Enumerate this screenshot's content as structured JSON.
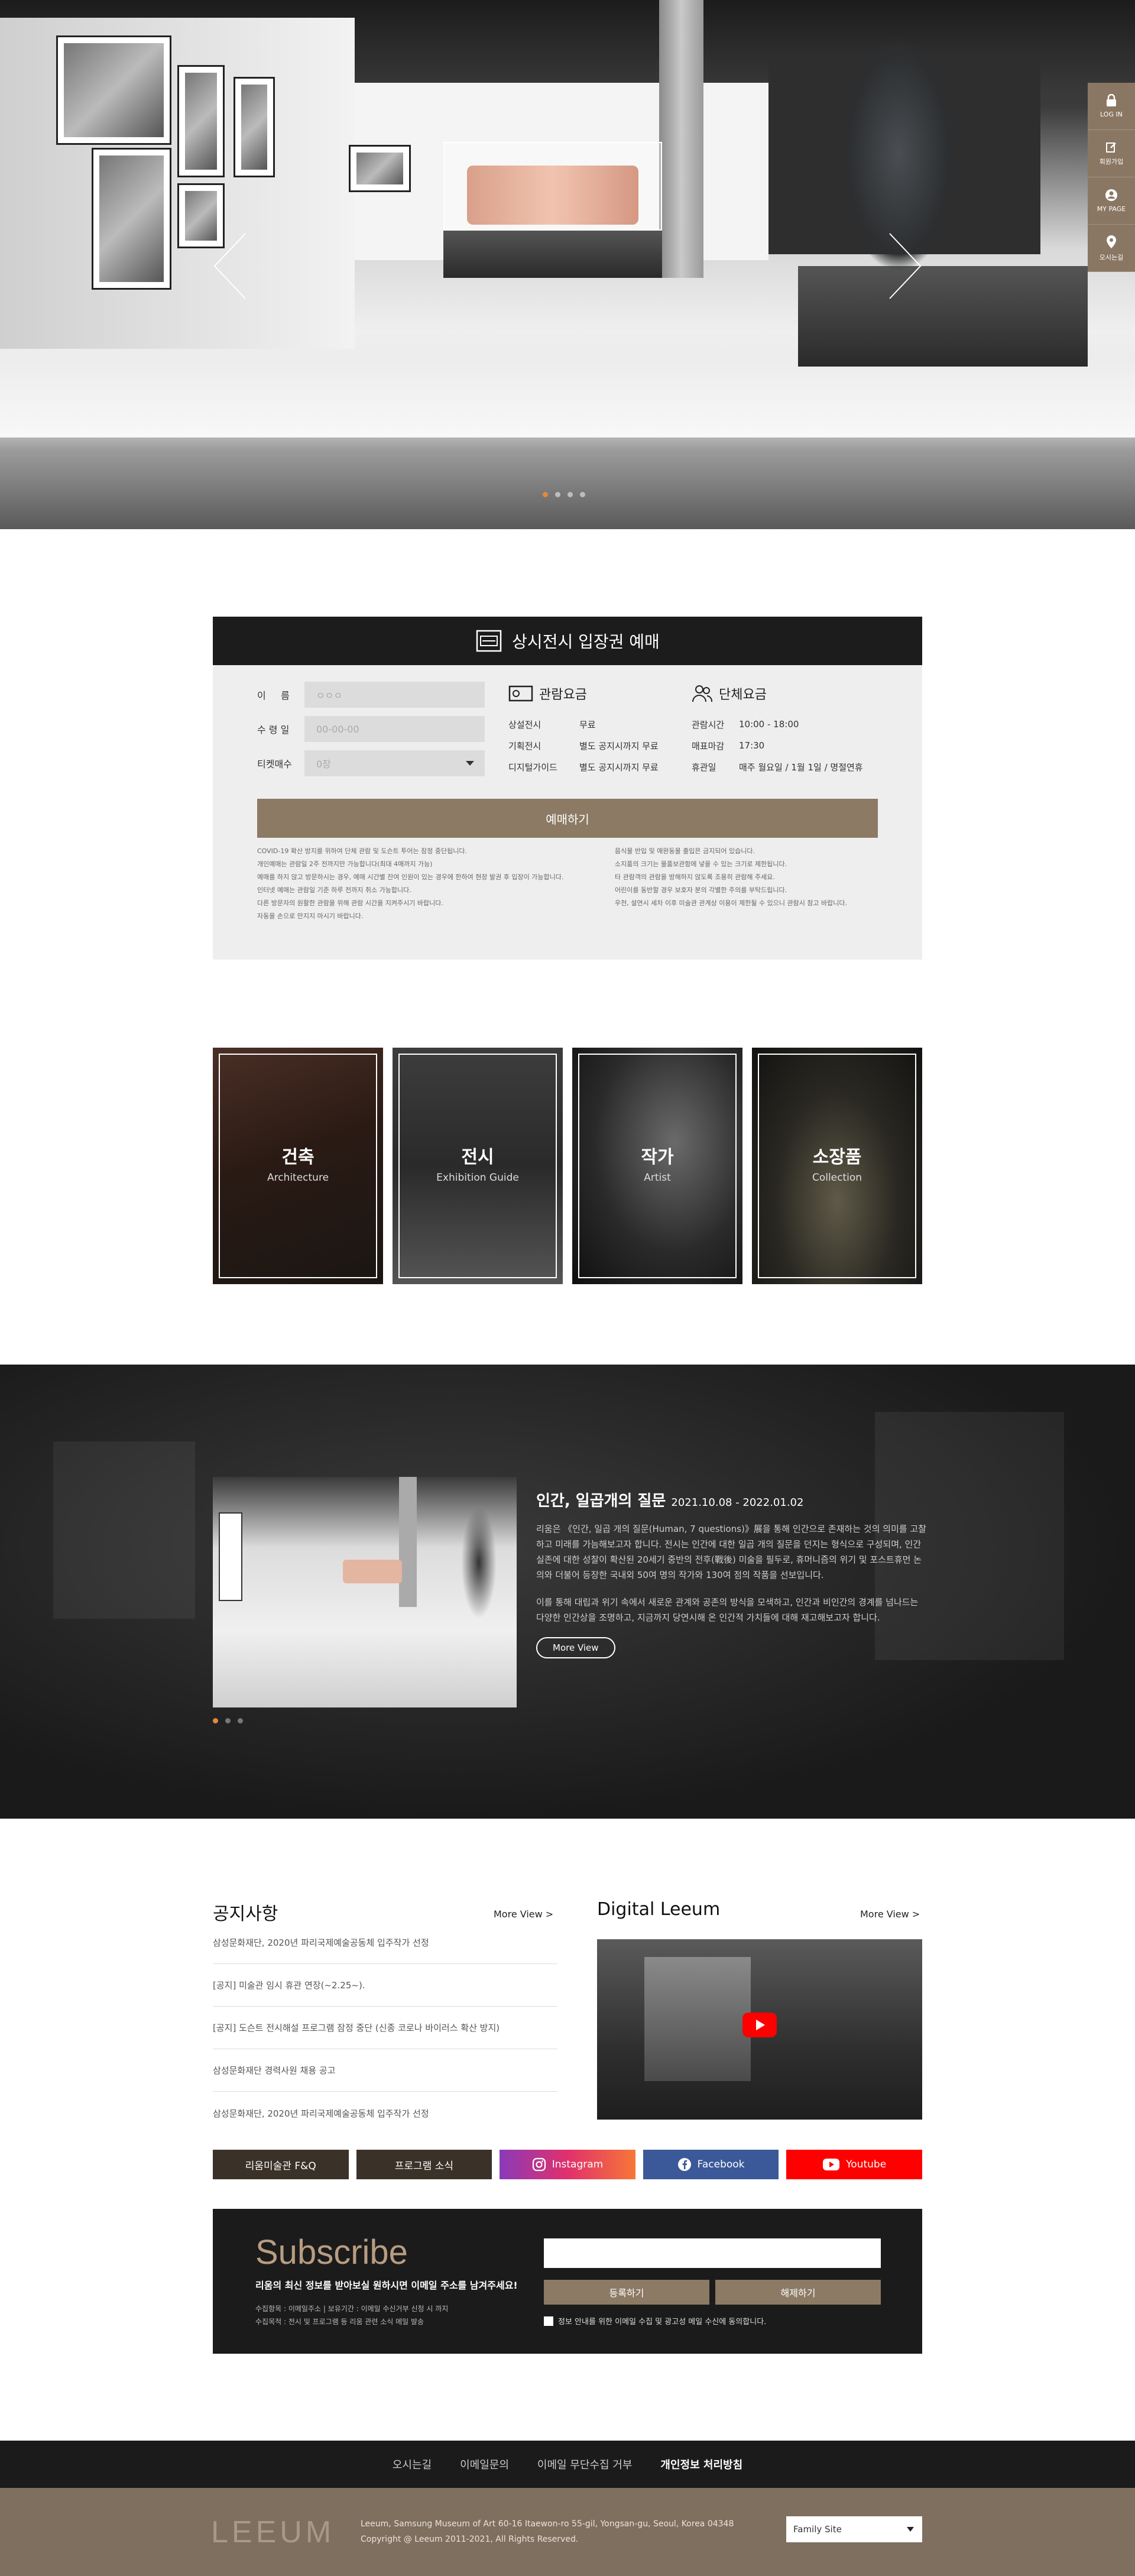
{
  "quick_menu": [
    {
      "label": "LOG IN",
      "icon": "lock-icon"
    },
    {
      "label": "회원가입",
      "icon": "edit-icon"
    },
    {
      "label": "MY PAGE",
      "icon": "user-icon"
    },
    {
      "label": "오시는길",
      "icon": "location-pin-icon"
    }
  ],
  "hero": {
    "slide_count": 4,
    "active_slide": 1
  },
  "ticket": {
    "title": "상시전시 입장권 예매",
    "form": [
      {
        "label": "이     름",
        "placeholder": "ㅇㅇㅇ"
      },
      {
        "label": "수 령 일",
        "placeholder": "00-00-00"
      },
      {
        "label": "티켓매수",
        "placeholder": "0장"
      }
    ],
    "fee_title": "관람요금",
    "fees": [
      {
        "k": "상설전시",
        "v": "무료"
      },
      {
        "k": "기획전시",
        "v": "별도 공지시까지 무료"
      },
      {
        "k": "디지털가이드",
        "v": "별도 공지시까지 무료"
      }
    ],
    "group_title": "단체요금",
    "hours": [
      {
        "k": "관람시간",
        "v": "10:00 - 18:00"
      },
      {
        "k": "매표마감",
        "v": "17:30"
      },
      {
        "k": "휴관일",
        "v": "매주 월요일 / 1월 1일 / 명절연휴"
      }
    ],
    "buy_label": "예매하기",
    "notes_left": [
      "COVID-19 확산 방지를 위하여 단체 관람 및 도슨트 투어는 잠정 중단됩니다.",
      "개인예매는 관람일 2주 전까지만 가능합니다(최대 4매까지 가능)",
      "예매를 하지 않고 방문하시는 경우, 예매 시간별 잔여 인원이 있는 경우에 한하여 현장 발권 후 입장이 가능합니다.",
      "인터넷 예매는 관람일 기준 하루 전까지 취소 가능합니다.",
      "다른 방문자의 원활한 관람을 위해 관람 시간을 지켜주시기 바랍니다.",
      "자동을 손으로 만지지 마시기 바랍니다."
    ],
    "notes_right": [
      "음식물 반입 및 애완동물 출입은 금지되어 있습니다.",
      "소지품의 크기는 물품보관함에 넣을 수 있는 크기로 제한됩니다.",
      "타 관람객의 관람을 방해하지 않도록 조용히 관람해 주세요.",
      "어린이를 동반할 경우 보호자 분의 각별한 주의를 부탁드립니다.",
      "우천, 설연시 세차 이후 미술관 관계상 이용이 제한될 수 있으니 관람시 참고 바랍니다."
    ]
  },
  "cards": [
    {
      "title": "건축",
      "sub": "Architecture"
    },
    {
      "title": "전시",
      "sub": "Exhibition Guide"
    },
    {
      "title": "작가",
      "sub": "Artist"
    },
    {
      "title": "소장품",
      "sub": "Collection"
    }
  ],
  "exhibition": {
    "title": "인간, 일곱개의 질문",
    "date": "2021.10.08 - 2022.01.02",
    "p1": "리움은 《인간, 일곱 개의 질문(Human, 7 questions)》展을 통해 인간으로 존재하는 것의 의미를 고찰하고 미래를 가늠해보고자 합니다. 전시는 인간에 대한 일곱 개의 질문을 던지는 형식으로 구성되며, 인간 실존에 대한 성찰이 확산된 20세기 중반의 전후(戰後) 미술을 필두로, 휴머니즘의 위기 및 포스트휴먼 논의와 더불어 등장한 국내외 50여 명의 작가와 130여 점의 작품을 선보입니다.",
    "p2": "이를 통해 대립과 위기 속에서 새로운 관계와 공존의 방식을 모색하고, 인간과 비인간의 경계를 넘나드는 다양한 인간상을 조명하고, 지금까지 당연시해 온 인간적 가치들에 대해 재고해보고자 합니다.",
    "more_label": "More View",
    "slide_count": 3,
    "active_slide": 1
  },
  "notices": {
    "title": "공지사항",
    "more": "More View >",
    "items": [
      "삼성문화재단, 2020년 파리국제예술공동체 입주작가 선정",
      "[공지] 미술관 임시 휴관 연장(~2.25~).",
      "[공지] 도슨트 전시해설 프로그램 잠정 중단 (신종 코로나 바이러스 확산 방지)",
      "삼성문화재단 경력사원 채용 공고",
      "삼성문화재단, 2020년 파리국제예술공동체 입주작가 선정"
    ]
  },
  "digital": {
    "title": "Digital Leeum",
    "more": "More View >"
  },
  "link_buttons": [
    {
      "label": "리움미술관 F&Q",
      "color": "#3a3128"
    },
    {
      "label": "프로그램 소식",
      "color": "#3a3128"
    },
    {
      "label": "Instagram",
      "icon": "instagram-icon"
    },
    {
      "label": "Facebook",
      "icon": "facebook-icon",
      "color": "#3b5998"
    },
    {
      "label": "Youtube",
      "icon": "youtube-icon",
      "color": "#ff0000"
    }
  ],
  "subscribe": {
    "title": "Subscribe",
    "desc": "리움의 최신 정보를 받아보실 원하시면 이메일 주소를 남겨주세요!",
    "small1": "수집항목 : 이메일주소 | 보유기간 : 이메일 수신거부 신청 시 까지",
    "small2": "수집목적 : 전시 및 프로그램 등 리움 관련 소식 메일 발송",
    "subscribe_label": "등록하기",
    "unsubscribe_label": "해제하기",
    "agree": "정보 안내를 위한 이메일 수집 및 광고성 메일 수신에 동의합니다."
  },
  "footer": {
    "nav": [
      "오시는길",
      "이메일문의",
      "이메일 무단수집 거부",
      "개인정보 처리방침"
    ],
    "logo": "LEEUM",
    "address": "Leeum, Samsung Museum of Art 60-16 Itaewon-ro 55-gil, Yongsan-gu, Seoul, Korea 04348",
    "copyright": "Copyright @ Leeum 2011-2021, All Rights Reserved.",
    "family_site": "Family Site"
  },
  "colors": {
    "brand": "#8c7a65",
    "dark": "#1b1b1b",
    "accent_dot": "#e08a3c"
  }
}
